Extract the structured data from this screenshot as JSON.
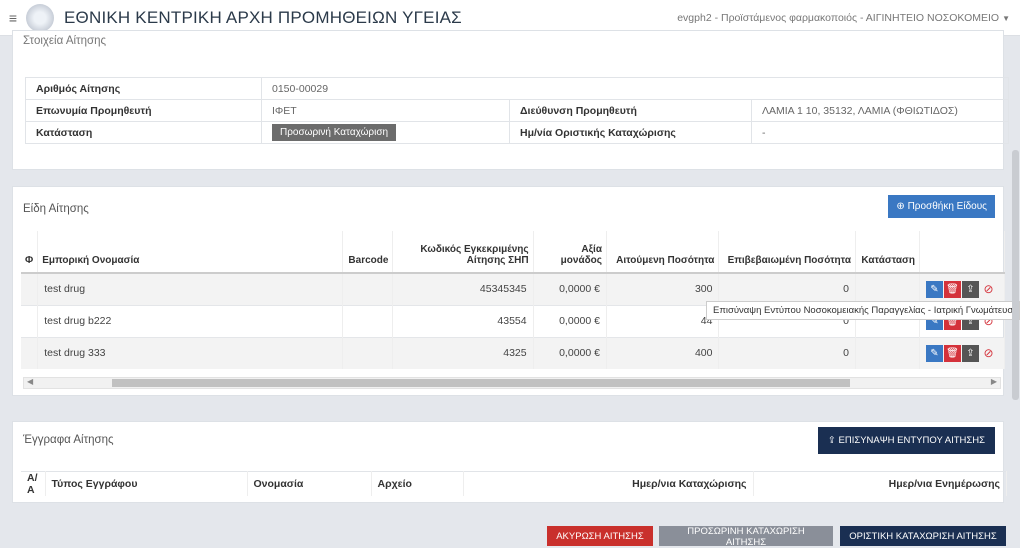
{
  "header": {
    "title": "ΕΘΝΙΚΗ ΚΕΝΤΡΙΚΗ ΑΡΧΗ ΠΡΟΜΗΘΕΙΩΝ ΥΓΕΙΑΣ",
    "user": "evgph2 - Προϊστάμενος φαρμακοποιός - ΑΙΓΙΝΗΤΕΙΟ ΝΟΣΟΚΟΜΕΙΟ"
  },
  "request": {
    "section_title": "Στοιχεία Αίτησης",
    "number_label": "Αριθμός Αίτησης",
    "number": "0150-00029",
    "supplier_label": "Επωνυμία Προμηθευτή",
    "supplier": "ΙΦΕΤ",
    "address_label": "Διεύθυνση Προμηθευτή",
    "address": "ΛΑΜΙΑ 1 10, 35132, ΛΑΜΙΑ (ΦΘΙΩΤΙΔΟΣ)",
    "status_label": "Κατάσταση",
    "status": "Προσωρινή Καταχώριση",
    "final_date_label": "Ημ/νία Οριστικής Καταχώρισης",
    "final_date": "-"
  },
  "items": {
    "section_title": "Είδη Αίτησης",
    "add_label": "Προσθήκη Είδους",
    "columns": {
      "phi": "Φ",
      "name": "Εμπορική Ονομασία",
      "barcode": "Barcode",
      "code": "Κωδικός Εγκεκριμένης Αίτησης ΣΗΠ",
      "unit": "Αξία μονάδος",
      "requested": "Αιτούμενη Ποσότητα",
      "confirmed": "Επιβεβαιωμένη Ποσότητα",
      "status": "Κατάσταση"
    },
    "rows": [
      {
        "name": "test drug",
        "barcode": "",
        "code": "45345345",
        "unit": "0,0000 €",
        "requested": "300",
        "confirmed": "0",
        "status": ""
      },
      {
        "name": "test drug b222",
        "barcode": "",
        "code": "43554",
        "unit": "0,0000 €",
        "requested": "44",
        "confirmed": "0",
        "status": ""
      },
      {
        "name": "test drug 333",
        "barcode": "",
        "code": "4325",
        "unit": "0,0000 €",
        "requested": "400",
        "confirmed": "0",
        "status": ""
      }
    ],
    "tooltip": "Επισύναψη Εντύπου Νοσοκομειακής Παραγγελίας - Ιατρική Γνωμάτευση"
  },
  "documents": {
    "section_title": "Έγγραφα Αίτησης",
    "attach_label": "ΕΠΙΣΥΝΑΨΗ ΕΝΤΥΠΟΥ ΑΙΤΗΣΗΣ",
    "columns": {
      "aa": "Α/Α",
      "type": "Τύπος Εγγράφου",
      "name": "Ονομασία",
      "file": "Αρχείο",
      "reg_date": "Ημερ/νια Καταχώρισης",
      "upd_date": "Ημερ/νια Ενημέρωσης"
    }
  },
  "footer": {
    "cancel": "ΑΚΥΡΩΣΗ ΑΙΤΗΣΗΣ",
    "temp": "ΠΡΟΣΩΡΙΝΗ ΚΑΤΑΧΩΡΙΣΗ ΑΙΤΗΣΗΣ",
    "final": "ΟΡΙΣΤΙΚΗ ΚΑΤΑΧΩΡΙΣΗ ΑΙΤΗΣΗΣ"
  },
  "icons": {
    "menu": "hamburger-icon",
    "add": "plus-circle-icon",
    "edit": "pencil-icon",
    "delete": "trash-icon",
    "upload": "upload-icon",
    "block": "ban-icon"
  }
}
